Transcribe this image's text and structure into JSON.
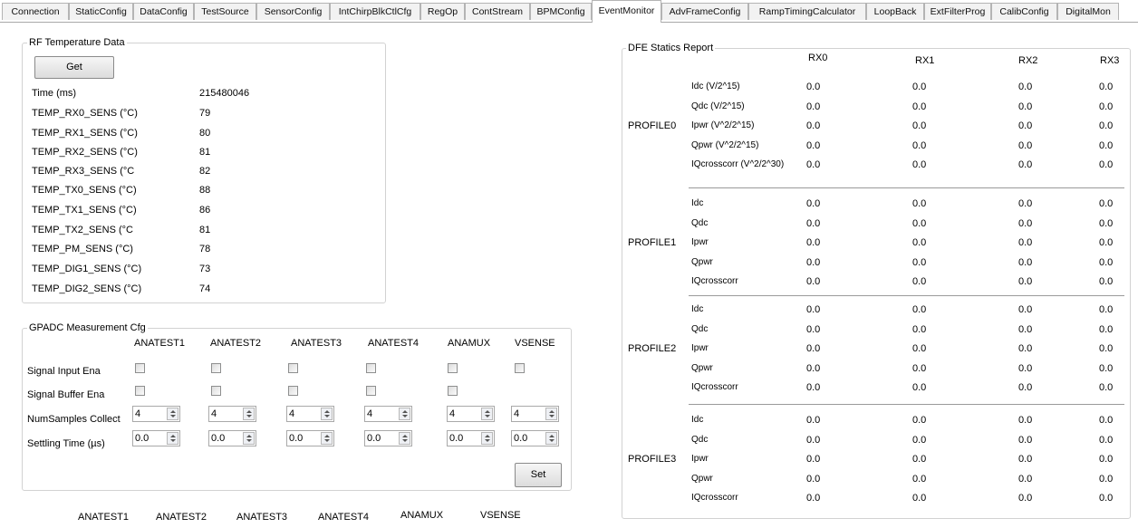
{
  "tabs": [
    "Connection",
    "StaticConfig",
    "DataConfig",
    "TestSource",
    "SensorConfig",
    "IntChirpBlkCtlCfg",
    "RegOp",
    "ContStream",
    "BPMConfig",
    "EventMonitor",
    "AdvFrameConfig",
    "RampTimingCalculator",
    "LoopBack",
    "ExtFilterProg",
    "CalibConfig",
    "DigitalMon"
  ],
  "active_tab": "EventMonitor",
  "rf_temp": {
    "title": "RF Temperature Data",
    "get_label": "Get",
    "rows": [
      {
        "label": "Time (ms)",
        "value": "215480046"
      },
      {
        "label": "TEMP_RX0_SENS (°C)",
        "value": "79"
      },
      {
        "label": "TEMP_RX1_SENS (°C)",
        "value": "80"
      },
      {
        "label": "TEMP_RX2_SENS (°C)",
        "value": "81"
      },
      {
        "label": "TEMP_RX3_SENS (°C",
        "value": "82"
      },
      {
        "label": "TEMP_TX0_SENS (°C)",
        "value": "88"
      },
      {
        "label": "TEMP_TX1_SENS (°C)",
        "value": "86"
      },
      {
        "label": "TEMP_TX2_SENS (°C",
        "value": "81"
      },
      {
        "label": "TEMP_PM_SENS (°C)",
        "value": "78"
      },
      {
        "label": "TEMP_DIG1_SENS (°C)",
        "value": "73"
      },
      {
        "label": "TEMP_DIG2_SENS (°C)",
        "value": "74"
      }
    ]
  },
  "gpadc": {
    "title": "GPADC Measurement Cfg",
    "columns": [
      "ANATEST1",
      "ANATEST2",
      "ANATEST3",
      "ANATEST4",
      "ANAMUX",
      "VSENSE"
    ],
    "row_labels": [
      "Signal Input Ena",
      "Signal Buffer Ena",
      "NumSamples Collect",
      "Settling Time (µs)"
    ],
    "num_samples": [
      "4",
      "4",
      "4",
      "4",
      "4",
      "4"
    ],
    "settling_time": [
      "0.0",
      "0.0",
      "0.0",
      "0.0",
      "0.0",
      "0.0"
    ],
    "set_label": "Set",
    "bottom_labels": [
      "ANATEST1",
      "ANATEST2",
      "ANATEST3",
      "ANATEST4",
      "ANAMUX",
      "VSENSE"
    ]
  },
  "dfe": {
    "title": "DFE Statics Report",
    "columns": [
      "RX0",
      "RX1",
      "RX2",
      "RX3"
    ],
    "profiles": [
      {
        "name": "PROFILE0",
        "metrics": [
          "Idc (V/2^15)",
          "Qdc (V/2^15)",
          "Ipwr (V^2/2^15)",
          "Qpwr (V^2/2^15)",
          "IQcrosscorr (V^2/2^30)"
        ],
        "values": [
          [
            "0.0",
            "0.0",
            "0.0",
            "0.0"
          ],
          [
            "0.0",
            "0.0",
            "0.0",
            "0.0"
          ],
          [
            "0.0",
            "0.0",
            "0.0",
            "0.0"
          ],
          [
            "0.0",
            "0.0",
            "0.0",
            "0.0"
          ],
          [
            "0.0",
            "0.0",
            "0.0",
            "0.0"
          ]
        ]
      },
      {
        "name": "PROFILE1",
        "metrics": [
          "Idc",
          "Qdc",
          "Ipwr",
          "Qpwr",
          "IQcrosscorr"
        ],
        "values": [
          [
            "0.0",
            "0.0",
            "0.0",
            "0.0"
          ],
          [
            "0.0",
            "0.0",
            "0.0",
            "0.0"
          ],
          [
            "0.0",
            "0.0",
            "0.0",
            "0.0"
          ],
          [
            "0.0",
            "0.0",
            "0.0",
            "0.0"
          ],
          [
            "0.0",
            "0.0",
            "0.0",
            "0.0"
          ]
        ]
      },
      {
        "name": "PROFILE2",
        "metrics": [
          "Idc",
          "Qdc",
          "Ipwr",
          "Qpwr",
          "IQcrosscorr"
        ],
        "values": [
          [
            "0.0",
            "0.0",
            "0.0",
            "0.0"
          ],
          [
            "0.0",
            "0.0",
            "0.0",
            "0.0"
          ],
          [
            "0.0",
            "0.0",
            "0.0",
            "0.0"
          ],
          [
            "0.0",
            "0.0",
            "0.0",
            "0.0"
          ],
          [
            "0.0",
            "0.0",
            "0.0",
            "0.0"
          ]
        ]
      },
      {
        "name": "PROFILE3",
        "metrics": [
          "Idc",
          "Qdc",
          "Ipwr",
          "Qpwr",
          "IQcrosscorr"
        ],
        "values": [
          [
            "0.0",
            "0.0",
            "0.0",
            "0.0"
          ],
          [
            "0.0",
            "0.0",
            "0.0",
            "0.0"
          ],
          [
            "0.0",
            "0.0",
            "0.0",
            "0.0"
          ],
          [
            "0.0",
            "0.0",
            "0.0",
            "0.0"
          ],
          [
            "0.0",
            "0.0",
            "0.0",
            "0.0"
          ]
        ]
      }
    ]
  }
}
